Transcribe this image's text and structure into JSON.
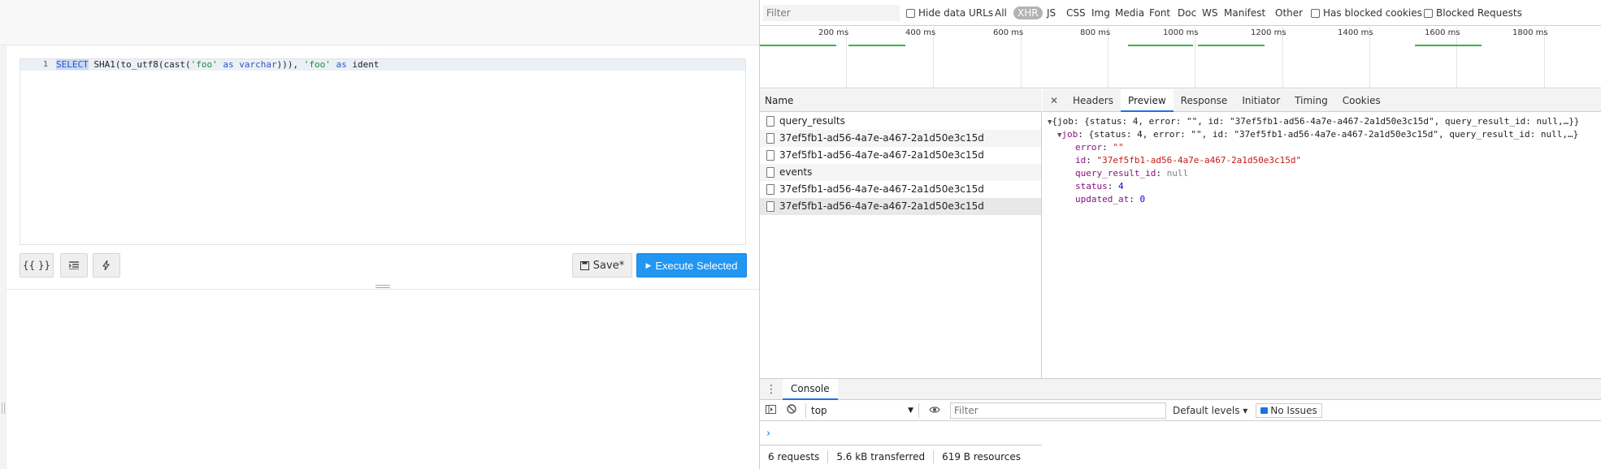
{
  "editor": {
    "line_number": "1",
    "code": {
      "kw_select": "SELECT",
      "fn_part1": " SHA1(to_utf8(cast(",
      "str_foo1": "'foo'",
      "kw_as1": " as ",
      "kw_varchar": "varchar",
      "fn_part2": "))), ",
      "str_foo2": "'foo'",
      "kw_as2": " as ",
      "ident": "ident"
    }
  },
  "toolbar": {
    "format_label": "{{ }}",
    "save_label": "Save*",
    "execute_label": "Execute Selected"
  },
  "devtools": {
    "filter_placeholder": "Filter",
    "hide_data_urls": "Hide data URLs",
    "types": [
      "All",
      "XHR",
      "JS",
      "CSS",
      "Img",
      "Media",
      "Font",
      "Doc",
      "WS",
      "Manifest",
      "Other"
    ],
    "active_type": "XHR",
    "has_blocked_cookies": "Has blocked cookies",
    "blocked_requests": "Blocked Requests",
    "timeline_ticks": [
      "200 ms",
      "400 ms",
      "600 ms",
      "800 ms",
      "1000 ms",
      "1200 ms",
      "1400 ms",
      "1600 ms",
      "1800 ms"
    ],
    "name_header": "Name",
    "requests": [
      "query_results",
      "37ef5fb1-ad56-4a7e-a467-2a1d50e3c15d",
      "37ef5fb1-ad56-4a7e-a467-2a1d50e3c15d",
      "events",
      "37ef5fb1-ad56-4a7e-a467-2a1d50e3c15d",
      "37ef5fb1-ad56-4a7e-a467-2a1d50e3c15d"
    ],
    "status": {
      "requests": "6 requests",
      "transferred": "5.6 kB transferred",
      "resources": "619 B resources"
    },
    "preview_tabs": [
      "Headers",
      "Preview",
      "Response",
      "Initiator",
      "Timing",
      "Cookies"
    ],
    "active_preview_tab": "Preview",
    "json": {
      "root_summary": "{job: {status: 4, error: \"\", id: \"37ef5fb1-ad56-4a7e-a467-2a1d50e3c15d\", query_result_id: null,…}}",
      "job_key": "job",
      "job_summary": "{status: 4, error: \"\", id: \"37ef5fb1-ad56-4a7e-a467-2a1d50e3c15d\", query_result_id: null,…}",
      "error_key": "error",
      "error_val": "\"\"",
      "id_key": "id",
      "id_val": "\"37ef5fb1-ad56-4a7e-a467-2a1d50e3c15d\"",
      "qr_key": "query_result_id",
      "qr_val": "null",
      "status_key": "status",
      "status_val": "4",
      "updated_key": "updated_at",
      "updated_val": "0"
    },
    "console": {
      "tab_label": "Console",
      "context": "top",
      "filter_placeholder": "Filter",
      "levels": "Default levels ▾",
      "issues": "No Issues",
      "prompt": "›"
    }
  }
}
